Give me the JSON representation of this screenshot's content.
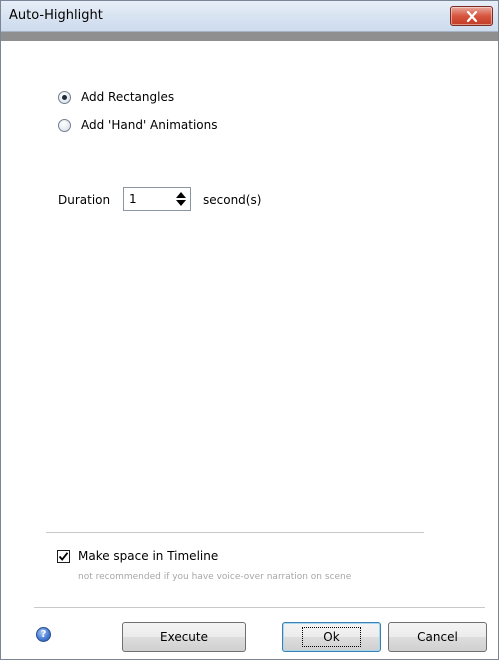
{
  "window": {
    "title": "Auto-Highlight"
  },
  "options": {
    "radios": [
      {
        "label": "Add Rectangles",
        "selected": true
      },
      {
        "label": "Add 'Hand' Animations",
        "selected": false
      }
    ]
  },
  "duration": {
    "label": "Duration",
    "value": "1",
    "unit": "second(s)"
  },
  "timeline": {
    "checkbox_label": "Make space in Timeline",
    "checked": true,
    "hint": "not recommended if you have voice-over narration on scene"
  },
  "buttons": {
    "execute": "Execute",
    "ok": "Ok",
    "cancel": "Cancel"
  },
  "help": {
    "icon_name": "help-icon",
    "glyph": "?"
  },
  "colors": {
    "close_button": "#d7553f",
    "header_bar": "#8f8f8f"
  }
}
